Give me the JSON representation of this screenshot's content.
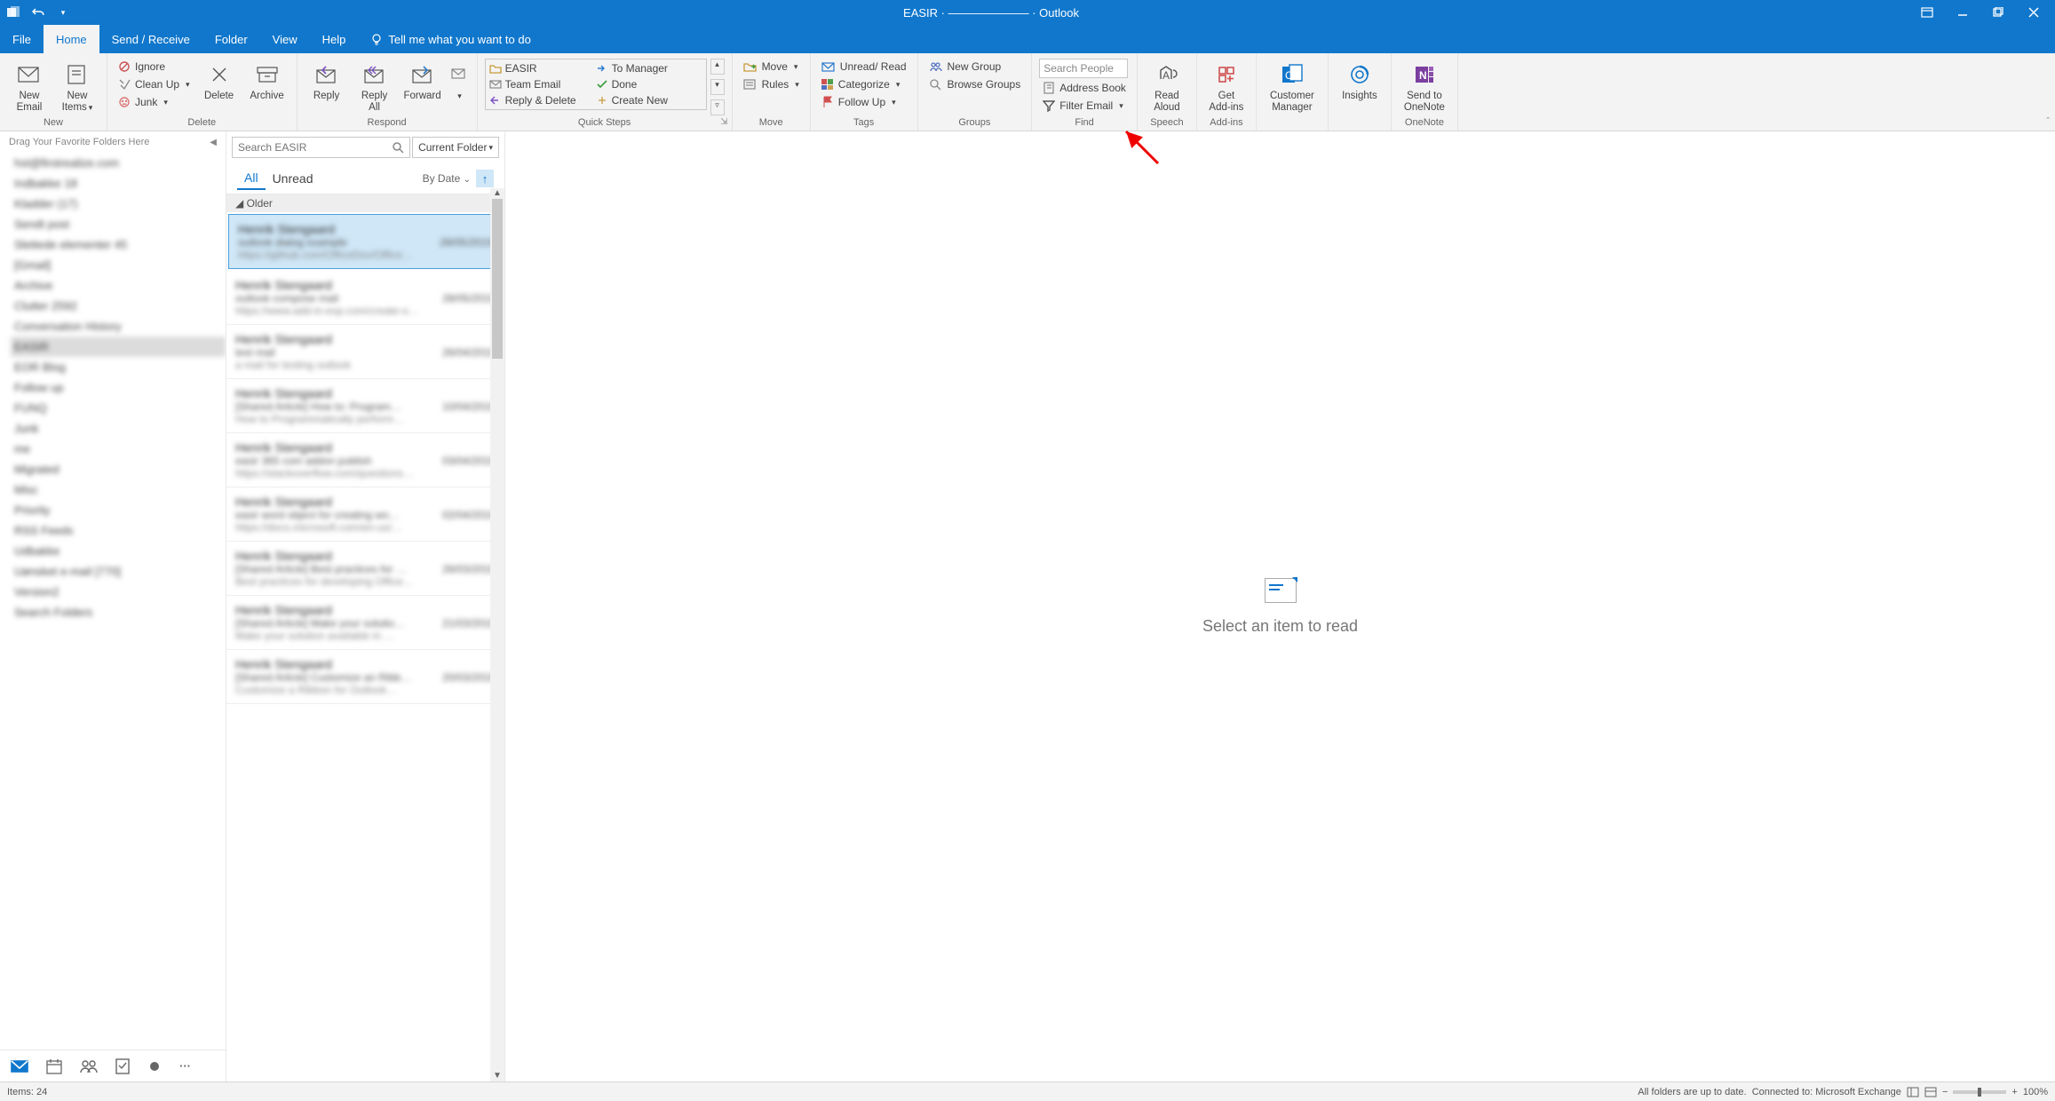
{
  "titlebar": {
    "title": "EASIR · ——————— · Outlook"
  },
  "tabs": {
    "file": "File",
    "home": "Home",
    "send_receive": "Send / Receive",
    "folder": "Folder",
    "view": "View",
    "help": "Help",
    "tellme": "Tell me what you want to do"
  },
  "ribbon": {
    "new": {
      "label": "New",
      "new_email": "New\nEmail",
      "new_items": "New\nItems"
    },
    "delete": {
      "label": "Delete",
      "ignore": "Ignore",
      "cleanup": "Clean Up",
      "junk": "Junk",
      "delete_btn": "Delete",
      "archive": "Archive"
    },
    "respond": {
      "label": "Respond",
      "reply": "Reply",
      "reply_all": "Reply\nAll",
      "forward": "Forward",
      "more": ""
    },
    "quicksteps": {
      "label": "Quick Steps",
      "items": [
        "EASIR",
        "To Manager",
        "Team Email",
        "Done",
        "Reply & Delete",
        "Create New"
      ]
    },
    "move": {
      "label": "Move",
      "move": "Move",
      "rules": "Rules"
    },
    "tags": {
      "label": "Tags",
      "unread": "Unread/ Read",
      "categorize": "Categorize",
      "followup": "Follow Up"
    },
    "groups": {
      "label": "Groups",
      "new_group": "New Group",
      "browse": "Browse Groups"
    },
    "find": {
      "label": "Find",
      "search_placeholder": "Search People",
      "address_book": "Address Book",
      "filter": "Filter Email"
    },
    "speech": {
      "label": "Speech",
      "read_aloud": "Read\nAloud"
    },
    "addins": {
      "label": "Add-ins",
      "get_addins": "Get\nAdd-ins"
    },
    "customer_mgr": {
      "label": "Customer\nManager"
    },
    "insights": {
      "label": "Insights"
    },
    "onenote": {
      "label": "OneNote",
      "send": "Send to\nOneNote"
    }
  },
  "nav": {
    "dragfav": "Drag Your Favorite Folders Here",
    "folders": [
      "hst@firstrealize.com",
      "Indbakke 18",
      "Kladder (17)",
      "Sendt post",
      "Slettede elementer 45",
      "[Gmail]",
      "Archive",
      "Clutter 2592",
      "Conversation History",
      "EASIR",
      "EOR Blog",
      "Follow up",
      "FUNQ",
      "Junk",
      "me",
      "Migrated",
      "Misc",
      "Priority",
      "RSS Feeds",
      "Udbakke",
      "Uønsket e-mail [770]",
      "Version2",
      "Search Folders"
    ],
    "selected_index": 9
  },
  "list": {
    "search_placeholder": "Search EASIR",
    "scope": "Current Folder",
    "filter_all": "All",
    "filter_unread": "Unread",
    "sort": "By Date",
    "group_header": "Older",
    "messages": [
      {
        "sender": "Henrik Stengaard",
        "subject": "outlook dialog example",
        "date": "28/05/2019",
        "preview": "https://github.com/OfficeDev/Office…"
      },
      {
        "sender": "Henrik Stengaard",
        "subject": "outlook compose mail",
        "date": "28/05/2019",
        "preview": "https://www.add-in-exp.com/create-o…"
      },
      {
        "sender": "Henrik Stengaard",
        "subject": "test mail",
        "date": "26/04/2019",
        "preview": "a mail for testing outlook"
      },
      {
        "sender": "Henrik Stengaard",
        "subject": "[Shared Article] How to: Program…",
        "date": "10/04/2019",
        "preview": "How to Programmatically perform…"
      },
      {
        "sender": "Henrik Stengaard",
        "subject": "easir 365 com addon publish",
        "date": "03/04/2019",
        "preview": "https://stackoverflow.com/questions…"
      },
      {
        "sender": "Henrik Stengaard",
        "subject": "easir word object for creating wo…",
        "date": "02/04/2019",
        "preview": "https://docs.microsoft.com/en-us/…"
      },
      {
        "sender": "Henrik Stengaard",
        "subject": "[Shared Article] Best practices for …",
        "date": "26/03/2019",
        "preview": "Best practices for developing Office…"
      },
      {
        "sender": "Henrik Stengaard",
        "subject": "[Shared Article] Make your solutio…",
        "date": "21/03/2019",
        "preview": "Make your solution available in …"
      },
      {
        "sender": "Henrik Stengaard",
        "subject": "[Shared Article] Customize an Ribb…",
        "date": "20/03/2019",
        "preview": "Customize a Ribbon for Outlook…"
      }
    ],
    "selected_index": 0
  },
  "reading": {
    "empty_msg": "Select an item to read"
  },
  "status": {
    "items": "Items: 24",
    "folders": "All folders are up to date.",
    "connected": "Connected to: Microsoft Exchange",
    "zoom": "100%"
  }
}
